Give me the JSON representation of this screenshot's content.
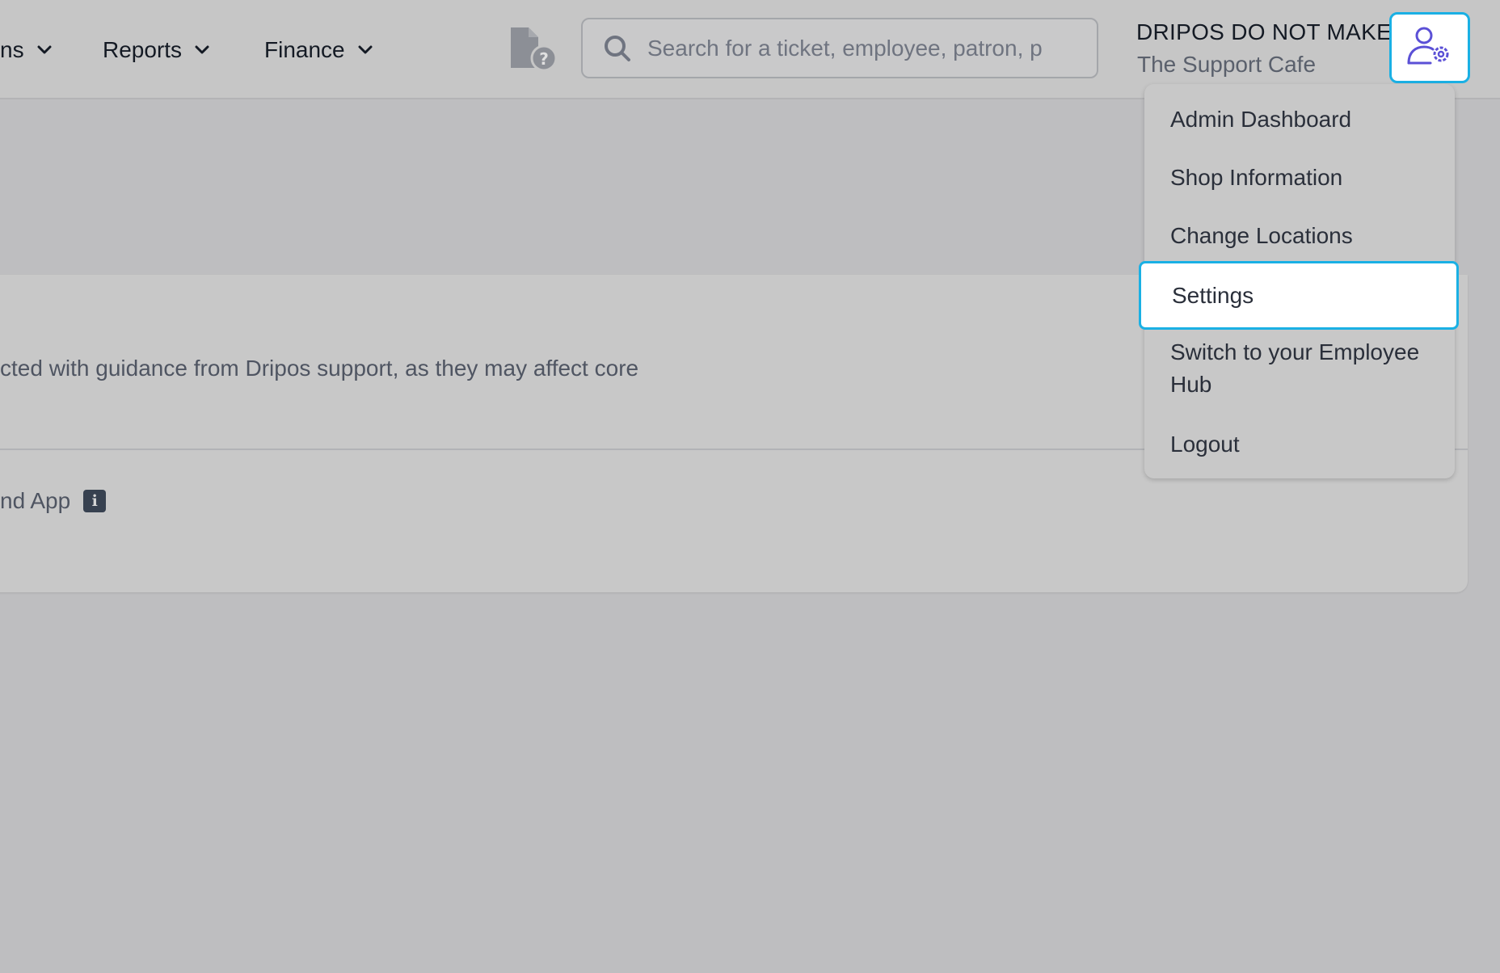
{
  "nav": {
    "items": [
      {
        "label": "ns"
      },
      {
        "label": "Reports"
      },
      {
        "label": "Finance"
      }
    ]
  },
  "search": {
    "placeholder": "Search for a ticket, employee, patron, p",
    "value": ""
  },
  "account": {
    "name": "DRIPOS DO NOT MAKE",
    "shop": "The Support Cafe"
  },
  "main": {
    "description": "cted with guidance from Dripos support, as they may affect core",
    "setting_label": "nd App",
    "info_glyph": "i"
  },
  "menu": {
    "items": [
      {
        "label": "Admin Dashboard"
      },
      {
        "label": "Shop Information"
      },
      {
        "label": "Change Locations"
      },
      {
        "label": "Settings"
      },
      {
        "label": "Switch to your Employee Hub"
      },
      {
        "label": "Logout"
      }
    ],
    "highlighted": "Settings"
  },
  "icons": {
    "help": "document-question-icon",
    "search": "search-icon",
    "account": "user-gear-icon",
    "chevron": "chevron-down-icon",
    "info": "info-icon"
  },
  "colors": {
    "accent_focus": "#1ab0e4",
    "account_icon": "#5b50d6",
    "overlay_bg": "#bebec0"
  }
}
